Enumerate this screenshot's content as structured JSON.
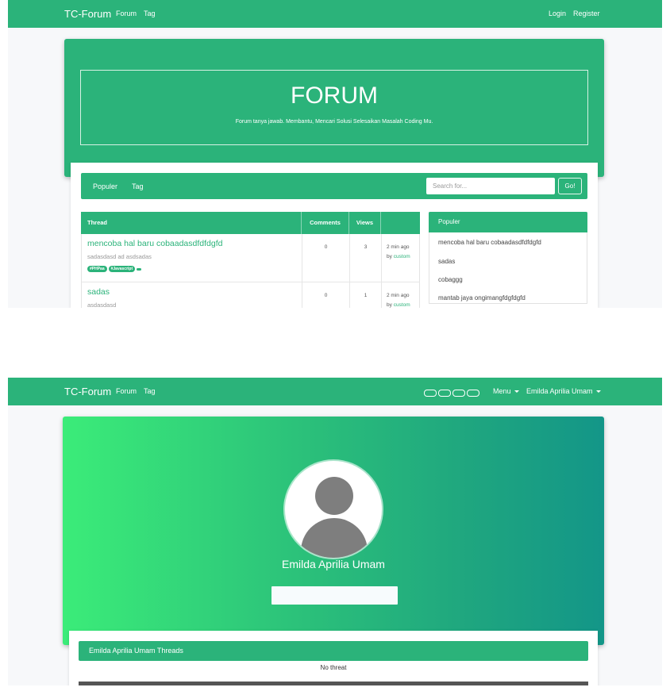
{
  "colors": {
    "brand": "#2bb37a",
    "hero_gradient_start": "#3bec79",
    "hero_gradient_end": "#139688"
  },
  "screen1": {
    "navbar": {
      "brand": "TC-Forum",
      "links": [
        "Forum",
        "Tag"
      ],
      "right_links": [
        "Login",
        "Register"
      ]
    },
    "hero": {
      "title": "FORUM",
      "subtitle": "Forum tanya jawab. Membantu, Mencari Solusi Selesaikan Masalah Coding Mu."
    },
    "subnav": {
      "items": [
        "Populer",
        "Tag"
      ],
      "search_placeholder": "Search for...",
      "go_label": "Go!"
    },
    "table": {
      "headers": [
        "Thread",
        "Comments",
        "Views",
        ""
      ],
      "rows": [
        {
          "title": "mencoba hal baru cobaadasdfdfdgfd",
          "desc": "sadasdasd ad asdsadas",
          "tags": [
            "#PHPaa",
            "#Javascript"
          ],
          "comments": "0",
          "views": "3",
          "time": "2 min ago",
          "by_prefix": "by",
          "author": "custom"
        },
        {
          "title": "sadas",
          "desc": "asdasdasd",
          "tags": [],
          "comments": "0",
          "views": "1",
          "time": "2 min ago",
          "by_prefix": "by",
          "author": "custom"
        }
      ]
    },
    "popular": {
      "title": "Populer",
      "items": [
        "mencoba hal baru cobaadasdfdfdgfd",
        "sadas",
        "cobaggg",
        "mantab jaya ongimangfdgfdgfd"
      ]
    }
  },
  "screen2": {
    "navbar": {
      "brand": "TC-Forum",
      "links": [
        "Forum",
        "Tag"
      ],
      "menu_label": "Menu",
      "user_label": "Emilda Aprilia Umam"
    },
    "icons": {
      "avatar": "user-avatar-icon",
      "theme_toggle": "theme-swatch-icon"
    },
    "profile": {
      "name": "Emilda Aprilia Umam",
      "input_value": ""
    },
    "threads": {
      "title": "Emilda Aprilia Umam Threads",
      "empty_text": "No threat"
    }
  }
}
